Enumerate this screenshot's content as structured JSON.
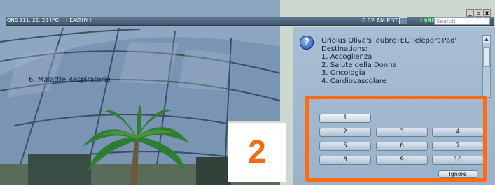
{
  "statusbar": {
    "parcel_text": "ONS 111, 22, 28 (PG) - HEALTHY !",
    "time": "6:02 AM PDT",
    "balance": "L$900",
    "search_placeholder": "Search"
  },
  "window_controls": {
    "minimize": "_",
    "restore": "▫",
    "close": "x"
  },
  "dialog": {
    "title_line1": "Oriolus Oliva's 'aubreTEC Teleport Pad'",
    "title_line2": "Destinations:",
    "destinations": [
      "1. Accoglienza",
      "2. Salute della Donna",
      "3. Oncologia",
      "4. Cardiovascolare"
    ],
    "option6": "6. Malattie Respiratorie",
    "buttons": [
      "1",
      "2",
      "3",
      "4",
      "5",
      "6",
      "7",
      "8",
      "9",
      "10"
    ],
    "ignore_label": "Ignore"
  },
  "step_label": "2",
  "colors": {
    "highlight": "#ff6a13",
    "step_label": "#f06c14",
    "balance": "#7fff6a"
  }
}
